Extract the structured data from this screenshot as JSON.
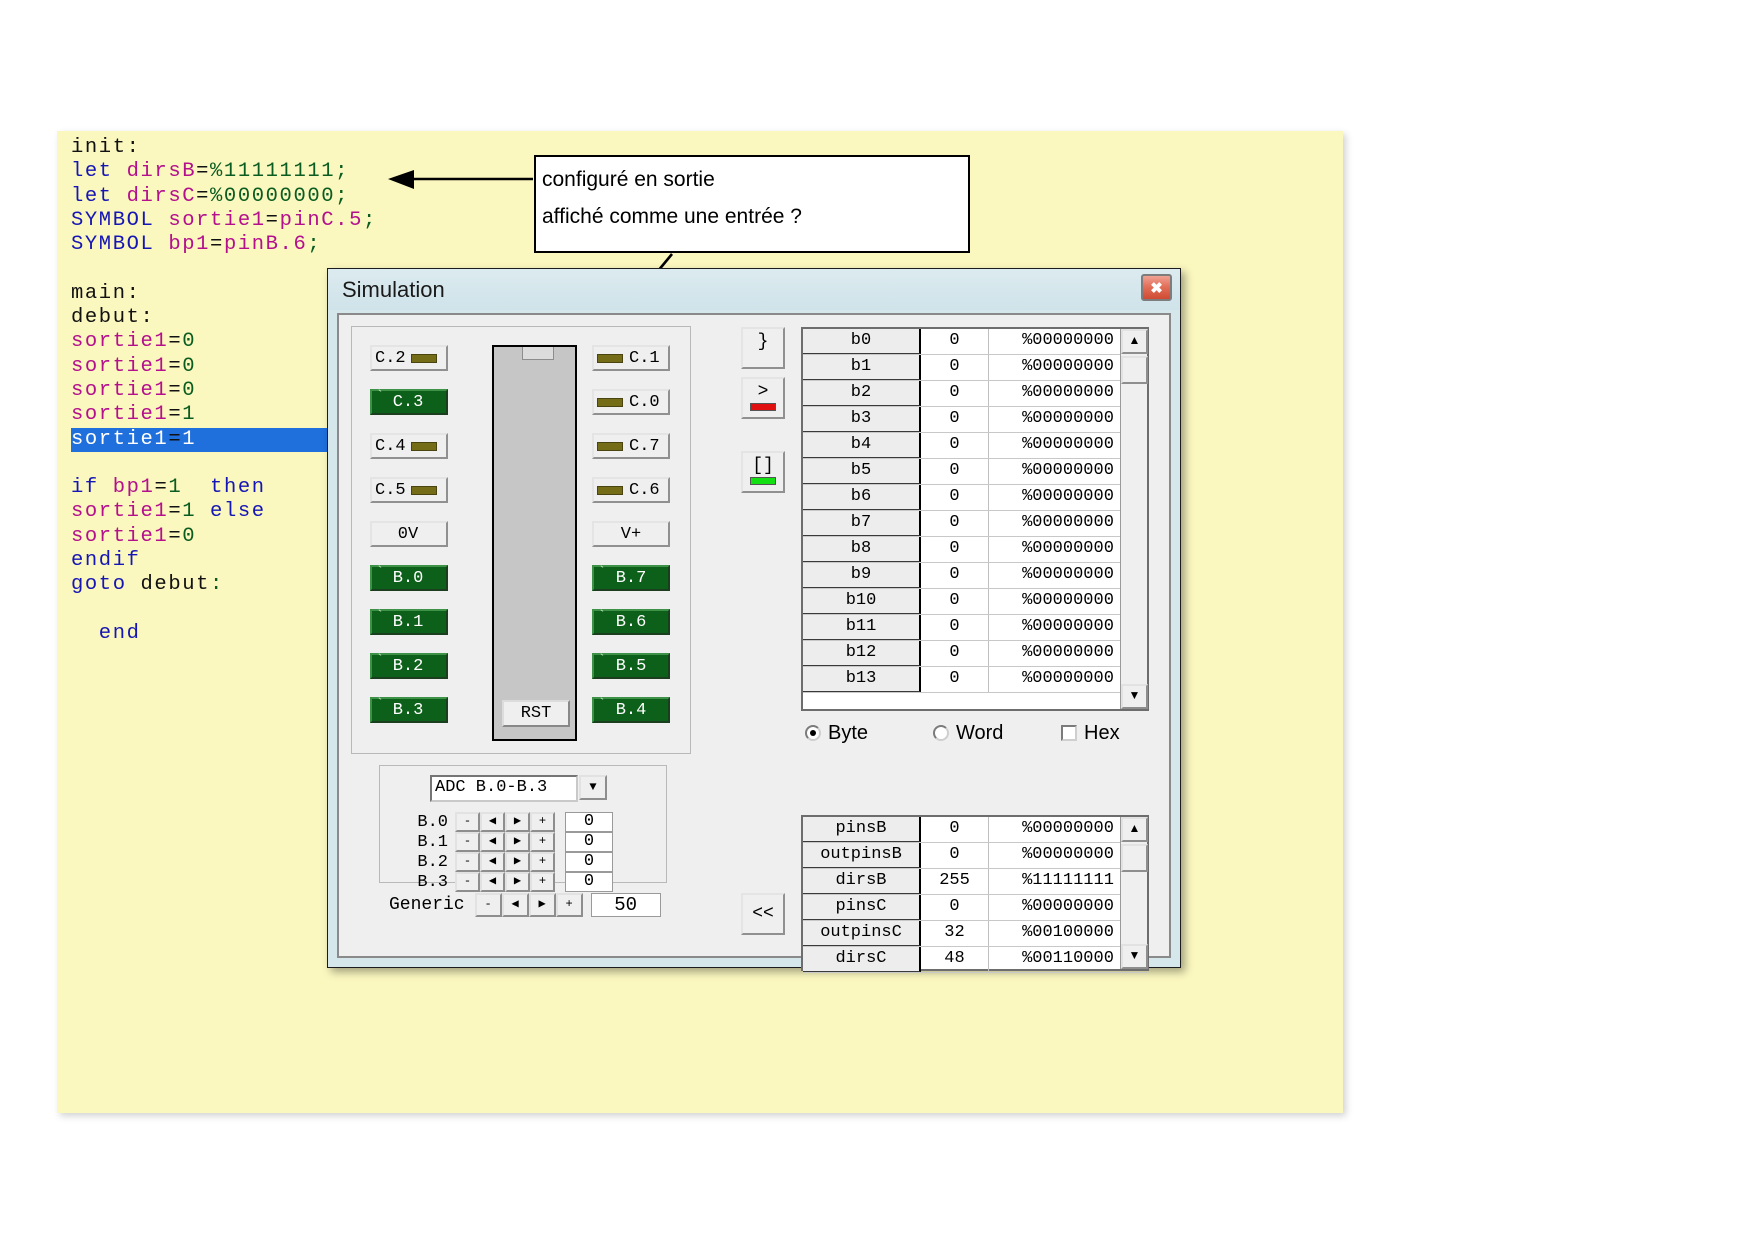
{
  "code": {
    "lines": [
      [
        {
          "t": "init:",
          "c": "d"
        }
      ],
      [
        {
          "t": "let ",
          "c": "k"
        },
        {
          "t": "dirsB",
          "c": "v"
        },
        {
          "t": "=",
          "c": "d"
        },
        {
          "t": "%11111111",
          "c": "n"
        },
        {
          "t": ";",
          "c": "n"
        }
      ],
      [
        {
          "t": "let ",
          "c": "k"
        },
        {
          "t": "dirsC",
          "c": "v"
        },
        {
          "t": "=",
          "c": "d"
        },
        {
          "t": "%00000000",
          "c": "n"
        },
        {
          "t": ";",
          "c": "n"
        }
      ],
      [
        {
          "t": "SYMBOL ",
          "c": "k"
        },
        {
          "t": "sortie1",
          "c": "v"
        },
        {
          "t": "=",
          "c": "d"
        },
        {
          "t": "pinC.5",
          "c": "v"
        },
        {
          "t": ";",
          "c": "n"
        }
      ],
      [
        {
          "t": "SYMBOL ",
          "c": "k"
        },
        {
          "t": "bp1",
          "c": "v"
        },
        {
          "t": "=",
          "c": "d"
        },
        {
          "t": "pinB.6",
          "c": "v"
        },
        {
          "t": ";",
          "c": "n"
        }
      ],
      [
        {
          "t": "",
          "c": "d"
        }
      ],
      [
        {
          "t": "main:",
          "c": "d"
        }
      ],
      [
        {
          "t": "debut:",
          "c": "d"
        }
      ],
      [
        {
          "t": "sortie1",
          "c": "v"
        },
        {
          "t": "=",
          "c": "d"
        },
        {
          "t": "0",
          "c": "n"
        }
      ],
      [
        {
          "t": "sortie1",
          "c": "v"
        },
        {
          "t": "=",
          "c": "d"
        },
        {
          "t": "0",
          "c": "n"
        }
      ],
      [
        {
          "t": "sortie1",
          "c": "v"
        },
        {
          "t": "=",
          "c": "d"
        },
        {
          "t": "0",
          "c": "n"
        }
      ],
      [
        {
          "t": "sortie1",
          "c": "v"
        },
        {
          "t": "=",
          "c": "d"
        },
        {
          "t": "1",
          "c": "n"
        }
      ],
      [
        {
          "t": "sortie1",
          "c": "v"
        },
        {
          "t": "=",
          "c": "d"
        },
        {
          "t": "1",
          "c": "n"
        }
      ],
      [
        {
          "t": "",
          "c": "d"
        }
      ],
      [
        {
          "t": "if ",
          "c": "k"
        },
        {
          "t": "bp1",
          "c": "v"
        },
        {
          "t": "=",
          "c": "d"
        },
        {
          "t": "1",
          "c": "n"
        },
        {
          "t": "  ",
          "c": "d"
        },
        {
          "t": "then",
          "c": "k"
        }
      ],
      [
        {
          "t": "sortie1",
          "c": "v"
        },
        {
          "t": "=",
          "c": "d"
        },
        {
          "t": "1",
          "c": "n"
        },
        {
          "t": " ",
          "c": "d"
        },
        {
          "t": "else",
          "c": "k"
        }
      ],
      [
        {
          "t": "sortie1",
          "c": "v"
        },
        {
          "t": "=",
          "c": "d"
        },
        {
          "t": "0",
          "c": "n"
        }
      ],
      [
        {
          "t": "endif",
          "c": "k"
        }
      ],
      [
        {
          "t": "goto ",
          "c": "k"
        },
        {
          "t": "debut",
          "c": "d"
        },
        {
          "t": ":",
          "c": "n"
        }
      ],
      [
        {
          "t": "",
          "c": "d"
        }
      ],
      [
        {
          "t": "  end",
          "c": "k"
        }
      ]
    ],
    "selected_line_index": 12
  },
  "callout": {
    "line1": "configuré en sortie",
    "line2": "affiché comme une entrée  ?"
  },
  "sim": {
    "title": "Simulation",
    "close_label": "✖",
    "chip": {
      "reset_label": "RST",
      "left_pins": [
        {
          "label": "C.2",
          "state": "off"
        },
        {
          "label": "C.3",
          "state": "on"
        },
        {
          "label": "C.4",
          "state": "off"
        },
        {
          "label": "C.5",
          "state": "off"
        },
        {
          "label": "0V",
          "state": "power"
        },
        {
          "label": "B.0",
          "state": "on"
        },
        {
          "label": "B.1",
          "state": "on"
        },
        {
          "label": "B.2",
          "state": "on"
        },
        {
          "label": "B.3",
          "state": "on"
        }
      ],
      "right_pins": [
        {
          "label": "C.1",
          "state": "off"
        },
        {
          "label": "C.0",
          "state": "off"
        },
        {
          "label": "C.7",
          "state": "off"
        },
        {
          "label": "C.6",
          "state": "off"
        },
        {
          "label": "V+",
          "state": "power"
        },
        {
          "label": "B.7",
          "state": "on"
        },
        {
          "label": "B.6",
          "state": "on"
        },
        {
          "label": "B.5",
          "state": "on"
        },
        {
          "label": "B.4",
          "state": "on"
        }
      ]
    },
    "toolbar": {
      "step_label": "}",
      "run_label": ">",
      "run_bar_color": "#e01010",
      "stop_label": "[]",
      "stop_bar_color": "#12e012",
      "back_label": "<<"
    },
    "adc": {
      "selected": "ADC B.0-B.3",
      "dec_label": "-",
      "left_label": "◀",
      "right_label": "▶",
      "inc_label": "+",
      "rows": [
        {
          "name": "B.0",
          "value": "0"
        },
        {
          "name": "B.1",
          "value": "0"
        },
        {
          "name": "B.2",
          "value": "0"
        },
        {
          "name": "B.3",
          "value": "0"
        }
      ],
      "generic_label": "Generic",
      "generic_value": "50"
    },
    "variables": [
      {
        "name": "b0",
        "dec": "0",
        "bin": "%00000000"
      },
      {
        "name": "b1",
        "dec": "0",
        "bin": "%00000000"
      },
      {
        "name": "b2",
        "dec": "0",
        "bin": "%00000000"
      },
      {
        "name": "b3",
        "dec": "0",
        "bin": "%00000000"
      },
      {
        "name": "b4",
        "dec": "0",
        "bin": "%00000000"
      },
      {
        "name": "b5",
        "dec": "0",
        "bin": "%00000000"
      },
      {
        "name": "b6",
        "dec": "0",
        "bin": "%00000000"
      },
      {
        "name": "b7",
        "dec": "0",
        "bin": "%00000000"
      },
      {
        "name": "b8",
        "dec": "0",
        "bin": "%00000000"
      },
      {
        "name": "b9",
        "dec": "0",
        "bin": "%00000000"
      },
      {
        "name": "b10",
        "dec": "0",
        "bin": "%00000000"
      },
      {
        "name": "b11",
        "dec": "0",
        "bin": "%00000000"
      },
      {
        "name": "b12",
        "dec": "0",
        "bin": "%00000000"
      },
      {
        "name": "b13",
        "dec": "0",
        "bin": "%00000000"
      }
    ],
    "pins": [
      {
        "name": "pinsB",
        "dec": "0",
        "bin": "%00000000"
      },
      {
        "name": "outpinsB",
        "dec": "0",
        "bin": "%00000000"
      },
      {
        "name": "dirsB",
        "dec": "255",
        "bin": "%11111111"
      },
      {
        "name": "pinsC",
        "dec": "0",
        "bin": "%00000000"
      },
      {
        "name": "outpinsC",
        "dec": "32",
        "bin": "%00100000"
      },
      {
        "name": "dirsC",
        "dec": "48",
        "bin": "%00110000"
      }
    ],
    "options": {
      "byte_label": "Byte",
      "byte_selected": true,
      "word_label": "Word",
      "word_selected": false,
      "hex_label": "Hex",
      "hex_checked": false
    },
    "scroll": {
      "up": "▲",
      "down": "▼"
    }
  }
}
